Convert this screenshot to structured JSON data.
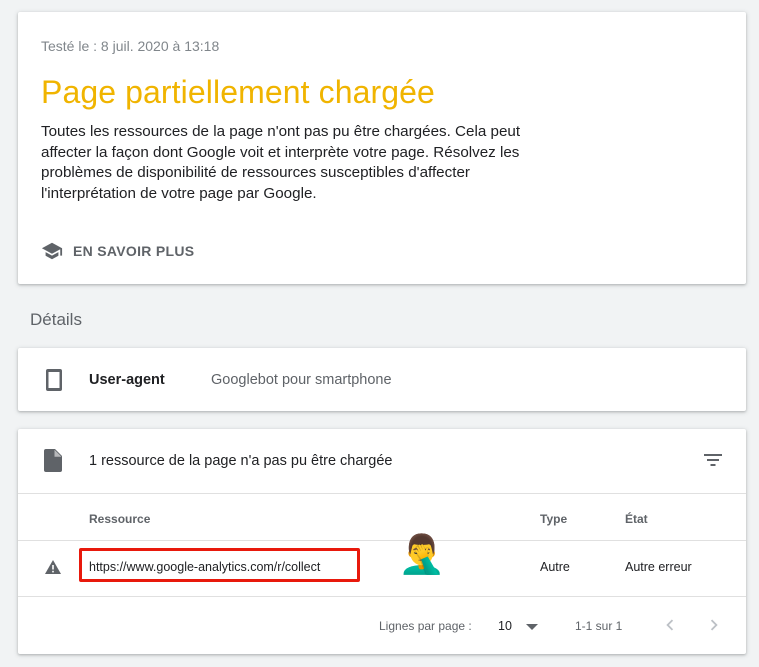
{
  "summary": {
    "tested": "Testé le : 8 juil. 2020 à 13:18",
    "status_title": "Page partiellement chargée",
    "description": "Toutes les ressources de la page n'ont pas pu être chargées. Cela peut affecter la façon dont Google voit et interprète votre page. Résolvez les problèmes de disponibilité de ressources susceptibles d'affecter l'interprétation de votre page par Google.",
    "learn_more": "EN SAVOIR PLUS",
    "status_color": "#f0b400"
  },
  "details": {
    "section_title": "Détails",
    "user_agent_label": "User-agent",
    "user_agent_value": "Googlebot pour smartphone"
  },
  "resources": {
    "heading": "1 ressource de la page n'a pas pu être chargée",
    "columns": [
      "Ressource",
      "Type",
      "État"
    ],
    "rows": [
      {
        "url": "https://www.google-analytics.com/r/collect",
        "type": "Autre",
        "state": "Autre erreur",
        "emoji": "🤦‍♂️"
      }
    ],
    "footer": {
      "rows_per_page_label": "Lignes par page :",
      "rows_per_page_value": "10",
      "range": "1-1 sur 1"
    },
    "highlight_color": "#e8190c"
  },
  "icons": {
    "learn_more": "school-icon",
    "user_agent": "smartphone-icon",
    "resource": "document-icon",
    "filter": "filter-icon",
    "warning": "warning-icon",
    "prev": "chevron-left-icon",
    "next": "chevron-right-icon",
    "dropdown": "dropdown-arrow-icon"
  }
}
